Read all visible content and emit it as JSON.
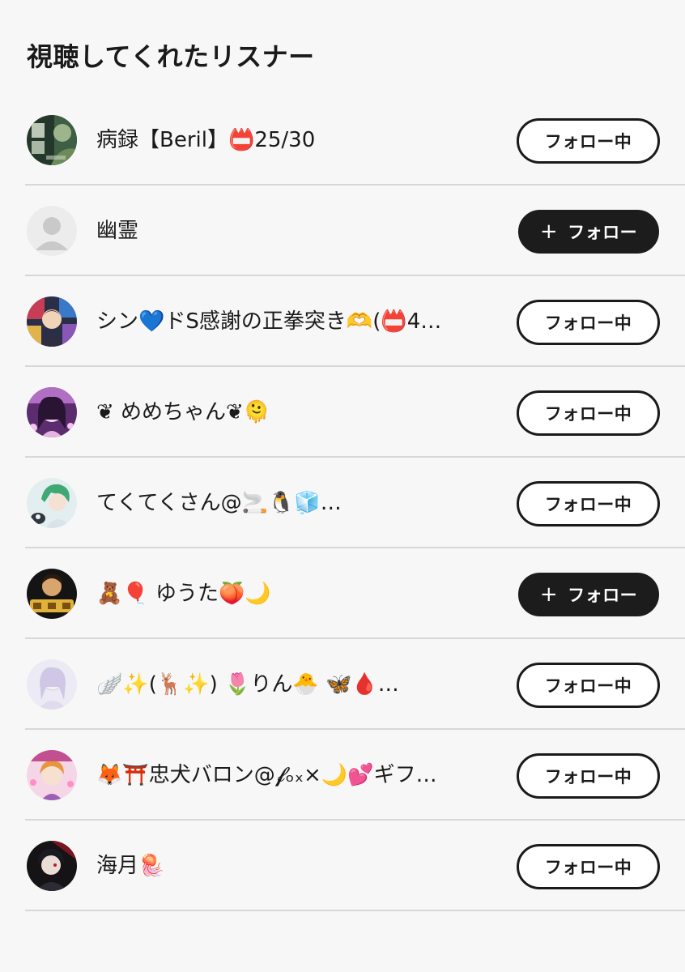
{
  "page": {
    "title": "視聴してくれたリスナー"
  },
  "listeners": [
    {
      "name": "病録【Beril】📛25/30",
      "avatar": "avatar-manga-green",
      "button": "フォロー中",
      "following": true
    },
    {
      "name": "幽霊",
      "avatar": "avatar-default-person",
      "button": "フォロー",
      "following": false
    },
    {
      "name": "シン💙ドS感謝の正拳突き🫶(📛4…",
      "avatar": "avatar-anime-collage",
      "button": "フォロー中",
      "following": true
    },
    {
      "name": "❦ めめちゃん❦🫠",
      "avatar": "avatar-anime-purple",
      "button": "フォロー中",
      "following": true
    },
    {
      "name": "てくてくさん@🚬🐧🧊…",
      "avatar": "avatar-anime-teal",
      "button": "フォロー中",
      "following": true
    },
    {
      "name": "🧸🎈 ゆうた🍑🌙",
      "avatar": "avatar-gold-text",
      "button": "フォロー",
      "following": false
    },
    {
      "name": "🪽✨(🦌✨) 🌷りん🐣 🦋🩸…",
      "avatar": "avatar-pale-lilac",
      "button": "フォロー中",
      "following": true
    },
    {
      "name": "🦊⛩️忠犬バロン@𝓯ₒₓ×🌙💕ギフ…",
      "avatar": "avatar-anime-pink",
      "button": "フォロー中",
      "following": true
    },
    {
      "name": "海月🪼",
      "avatar": "avatar-dark-red",
      "button": "フォロー中",
      "following": true
    }
  ],
  "plus_icon": "+",
  "colors": {
    "background": "#f7f7f7",
    "follow_fill": "#1c1c1c",
    "following_border": "#1a1a1a",
    "divider": "#d7d7d7"
  }
}
